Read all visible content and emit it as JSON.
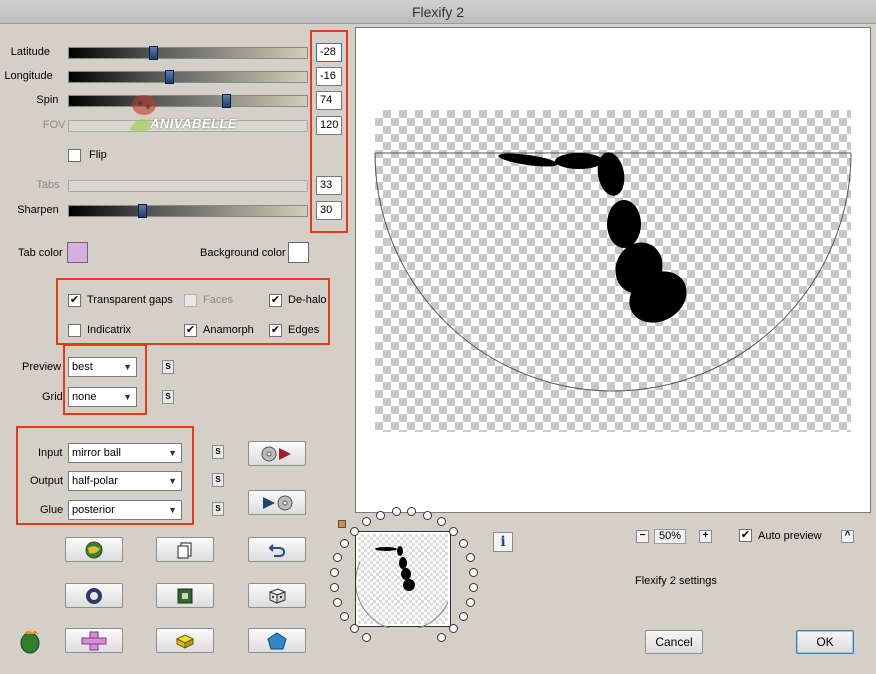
{
  "window": {
    "title": "Flexify 2"
  },
  "sliders": [
    {
      "label": "Latitude",
      "value": "-28",
      "fraction": 0.35,
      "disabled": false
    },
    {
      "label": "Longitude",
      "value": "-16",
      "fraction": 0.42,
      "disabled": false
    },
    {
      "label": "Spin",
      "value": "74",
      "fraction": 0.67,
      "disabled": false
    },
    {
      "label": "FOV",
      "value": "120",
      "fraction": 0.0,
      "disabled": true
    },
    {
      "label": "Tabs",
      "value": "33",
      "fraction": 0.0,
      "disabled": true
    },
    {
      "label": "Sharpen",
      "value": "30",
      "fraction": 0.3,
      "disabled": false
    }
  ],
  "flip": {
    "label": "Flip",
    "checked": false
  },
  "watermark": {
    "text": "ANIVABELLE"
  },
  "colors": {
    "tab_color_label": "Tab color",
    "tab_color": "#d9aee0",
    "background_color_label": "Background color",
    "background_color": "#ffffff",
    "highlight_red": "#e5391a"
  },
  "options": {
    "transparent_gaps": {
      "label": "Transparent gaps",
      "checked": true
    },
    "faces": {
      "label": "Faces",
      "checked": false
    },
    "de_halo": {
      "label": "De-halo",
      "checked": true
    },
    "indicatrix": {
      "label": "Indicatrix",
      "checked": false
    },
    "anamorph": {
      "label": "Anamorph",
      "checked": true
    },
    "edges": {
      "label": "Edges",
      "checked": true
    }
  },
  "preview_select": {
    "label": "Preview",
    "value": "best"
  },
  "grid_select": {
    "label": "Grid",
    "value": "none"
  },
  "input_select": {
    "label": "Input",
    "value": "mirror ball"
  },
  "output_select": {
    "label": "Output",
    "value": "half-polar"
  },
  "glue_select": {
    "label": "Glue",
    "value": "posterior"
  },
  "s_button": "S",
  "tool_buttons": {
    "row1": [
      "globe-icon",
      "copy-pages-icon",
      "undo-arrow-icon"
    ],
    "row2": [
      "ring-icon",
      "green-square-icon",
      "dice-icon"
    ],
    "row3": [
      "pink-cross-icon",
      "yellow-brick-icon",
      "blue-pentagon-icon"
    ],
    "side": [
      "disc-arrow-right-icon",
      "arrow-disc-right-icon"
    ]
  },
  "zoom": {
    "minus": "−",
    "value": "50%",
    "plus": "+"
  },
  "auto_preview": {
    "label": "Auto preview",
    "checked": true
  },
  "collapse_button": "^",
  "info_button": "i",
  "settings_label": "Flexify 2 settings",
  "actions": {
    "cancel": "Cancel",
    "ok": "OK"
  },
  "check_mark": "✔"
}
